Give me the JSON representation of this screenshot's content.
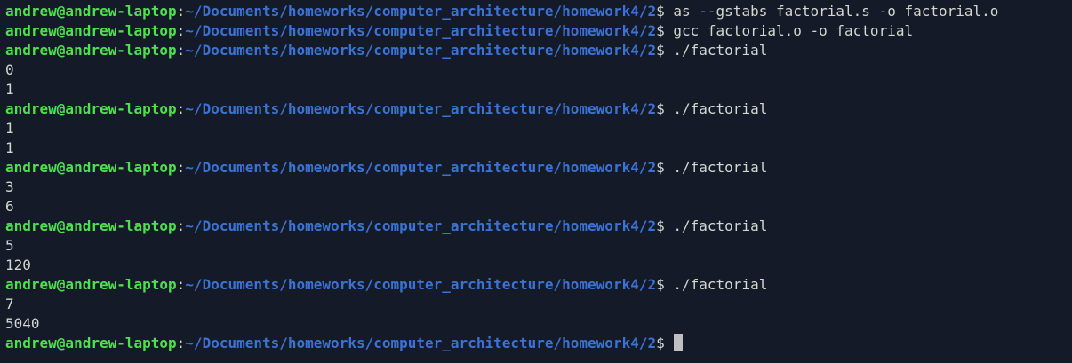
{
  "colors": {
    "background": "#141a28",
    "user_host": "#4ee04e",
    "path": "#3b73d4",
    "text": "#d3d7cf",
    "cursor": "#bfbfbf"
  },
  "prompt": {
    "user_host": "andrew@andrew-laptop",
    "separator": ":",
    "path": "~/Documents/homeworks/computer_architecture/homework4/2",
    "dollar": "$ "
  },
  "lines": [
    {
      "type": "prompt",
      "command": "as --gstabs factorial.s -o factorial.o"
    },
    {
      "type": "prompt",
      "command": "gcc factorial.o -o factorial"
    },
    {
      "type": "prompt",
      "command": "./factorial"
    },
    {
      "type": "output",
      "text": "0"
    },
    {
      "type": "output",
      "text": "1"
    },
    {
      "type": "prompt",
      "command": "./factorial"
    },
    {
      "type": "output",
      "text": "1"
    },
    {
      "type": "output",
      "text": "1"
    },
    {
      "type": "prompt",
      "command": "./factorial"
    },
    {
      "type": "output",
      "text": "3"
    },
    {
      "type": "output",
      "text": "6"
    },
    {
      "type": "prompt",
      "command": "./factorial"
    },
    {
      "type": "output",
      "text": "5"
    },
    {
      "type": "output",
      "text": "120"
    },
    {
      "type": "prompt",
      "command": "./factorial"
    },
    {
      "type": "output",
      "text": "7"
    },
    {
      "type": "output",
      "text": "5040"
    },
    {
      "type": "prompt",
      "command": "",
      "cursor": true
    }
  ]
}
